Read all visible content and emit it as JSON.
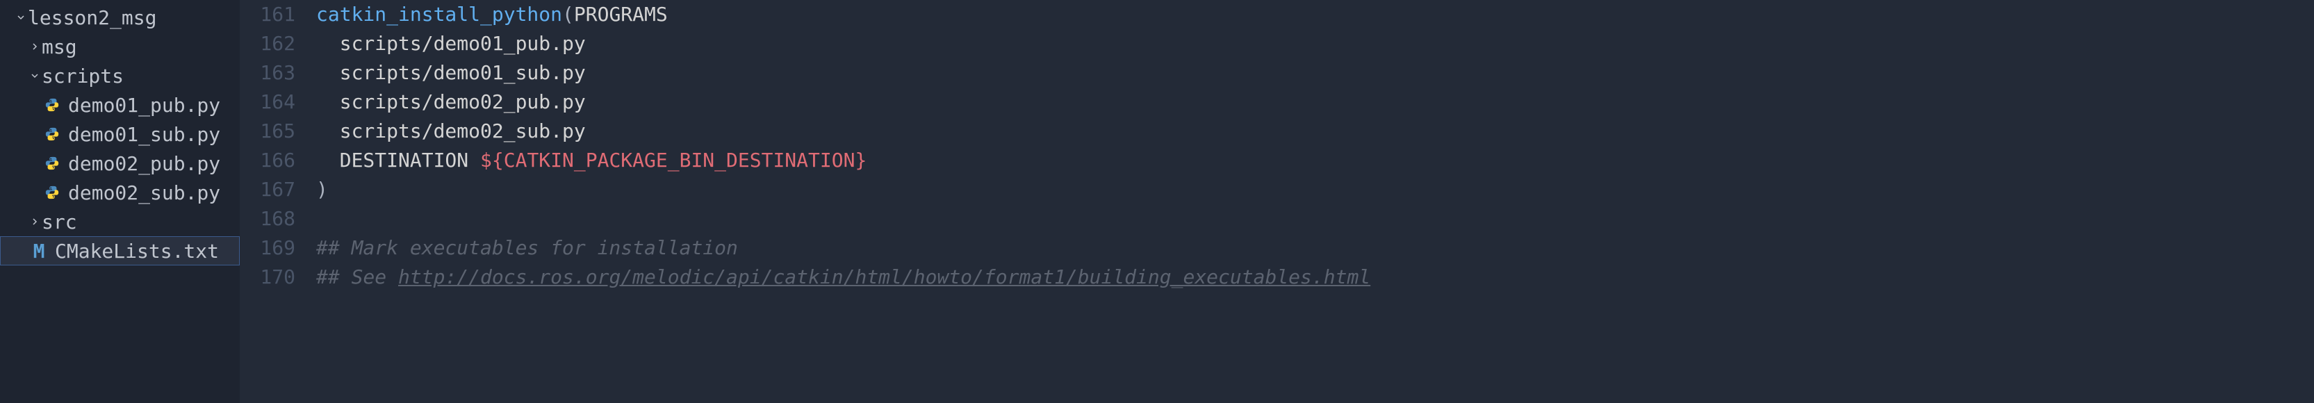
{
  "sidebar": {
    "items": [
      {
        "label": "lesson2_msg",
        "type": "folder",
        "expanded": true,
        "indent": 0
      },
      {
        "label": "msg",
        "type": "folder",
        "expanded": false,
        "indent": 1
      },
      {
        "label": "scripts",
        "type": "folder",
        "expanded": true,
        "indent": 1
      },
      {
        "label": "demo01_pub.py",
        "type": "python",
        "indent": 2
      },
      {
        "label": "demo01_sub.py",
        "type": "python",
        "indent": 2
      },
      {
        "label": "demo02_pub.py",
        "type": "python",
        "indent": 2
      },
      {
        "label": "demo02_sub.py",
        "type": "python",
        "indent": 2
      },
      {
        "label": "src",
        "type": "folder",
        "expanded": false,
        "indent": 1
      },
      {
        "label": "CMakeLists.txt",
        "type": "cmake",
        "indent": 1,
        "selected": true
      }
    ]
  },
  "editor": {
    "line_numbers": [
      "161",
      "162",
      "163",
      "164",
      "165",
      "166",
      "167",
      "168",
      "169",
      "170"
    ],
    "lines": {
      "l161_func": "catkin_install_python",
      "l161_paren": "(",
      "l161_arg": "PROGRAMS",
      "l162": "  scripts/demo01_pub.py",
      "l163": "  scripts/demo01_sub.py",
      "l164": "  scripts/demo02_pub.py",
      "l165": "  scripts/demo02_sub.py",
      "l166_dest": "  DESTINATION ",
      "l166_var": "${CATKIN_PACKAGE_BIN_DESTINATION}",
      "l167": ")",
      "l168": "",
      "l169": "## Mark executables for installation",
      "l170_prefix": "## See ",
      "l170_url": "http://docs.ros.org/melodic/api/catkin/html/howto/format1/building_executables.html"
    }
  }
}
